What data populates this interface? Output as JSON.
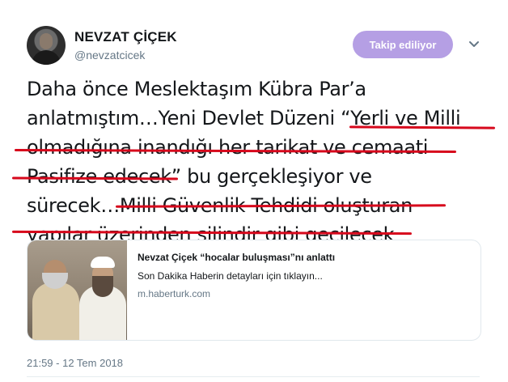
{
  "header": {
    "name": "NEVZAT ÇİÇEK",
    "handle": "@nevzatcicek",
    "follow_label": "Takip ediliyor",
    "chevron_icon": "chevron-down-icon",
    "accent_color": "#b59fe4"
  },
  "tweet": {
    "lines": [
      "Daha önce Meslektaşım Kübra Par’a",
      "anlatmıştım…Yeni Devlet Düzeni “Yerli ve Milli",
      "olmadığına inandığı her tarikat ve cemaati",
      "Pasifize edecek” bu gerçekleşiyor ve",
      "sürecek…Milli Güvenlik Tehdidi oluşturan",
      "yapılar üzerinden silindir gibi geçilecek"
    ],
    "underline_color": "#d7081c"
  },
  "card": {
    "title": "Nevzat Çiçek “hocalar buluşması”nı anlattı",
    "description": "Son Dakika Haberin detayları için tıklayın...",
    "domain": "m.haberturk.com",
    "image_icon": "news-photo-image"
  },
  "meta": {
    "timestamp": "21:59 - 12 Tem 2018"
  }
}
